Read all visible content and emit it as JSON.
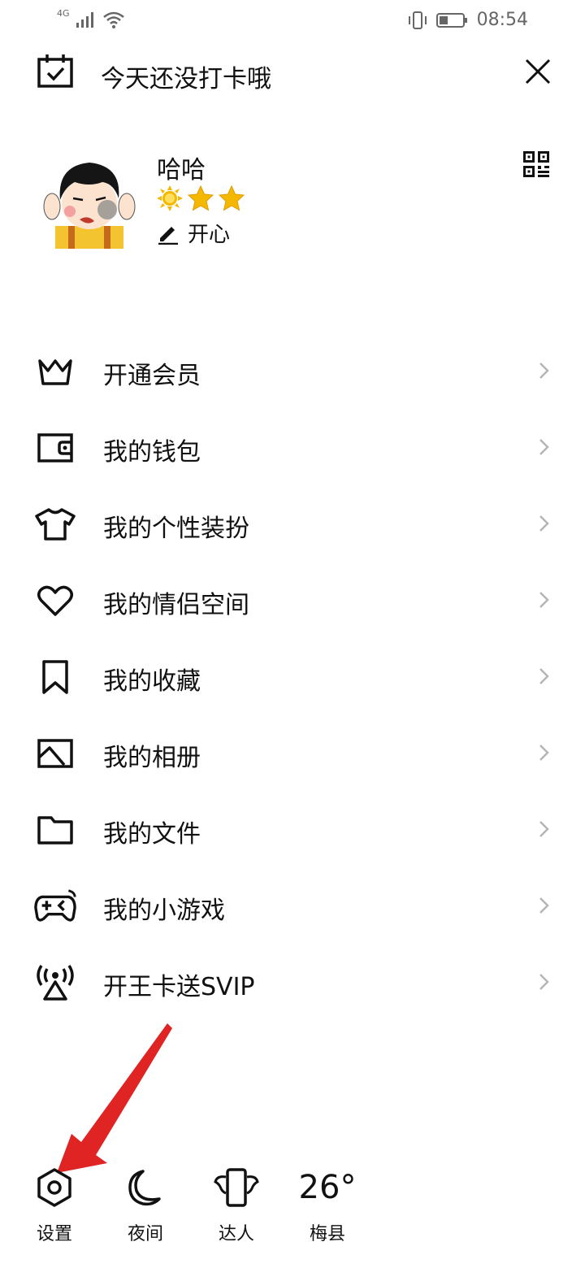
{
  "status_bar": {
    "network": "4G",
    "time": "08:54"
  },
  "header": {
    "checkin_text": "今天还没打卡哦"
  },
  "profile": {
    "username": "哈哈",
    "mood": "开心"
  },
  "menu": {
    "items": [
      {
        "label": "开通会员",
        "icon": "crown-icon"
      },
      {
        "label": "我的钱包",
        "icon": "wallet-icon"
      },
      {
        "label": "我的个性装扮",
        "icon": "tshirt-icon"
      },
      {
        "label": "我的情侣空间",
        "icon": "heart-icon"
      },
      {
        "label": "我的收藏",
        "icon": "bookmark-icon"
      },
      {
        "label": "我的相册",
        "icon": "image-icon"
      },
      {
        "label": "我的文件",
        "icon": "folder-icon"
      },
      {
        "label": "我的小游戏",
        "icon": "gamepad-icon"
      },
      {
        "label": "开王卡送SVIP",
        "icon": "signal-tower-icon"
      }
    ]
  },
  "bottom_bar": {
    "settings_label": "设置",
    "night_label": "夜间",
    "expert_label": "达人",
    "temperature": "26°",
    "city": "梅县"
  },
  "colors": {
    "text": "#111111",
    "chevron": "#b5b5b5",
    "annotation_arrow": "#e02424",
    "star": "#f5b800"
  }
}
